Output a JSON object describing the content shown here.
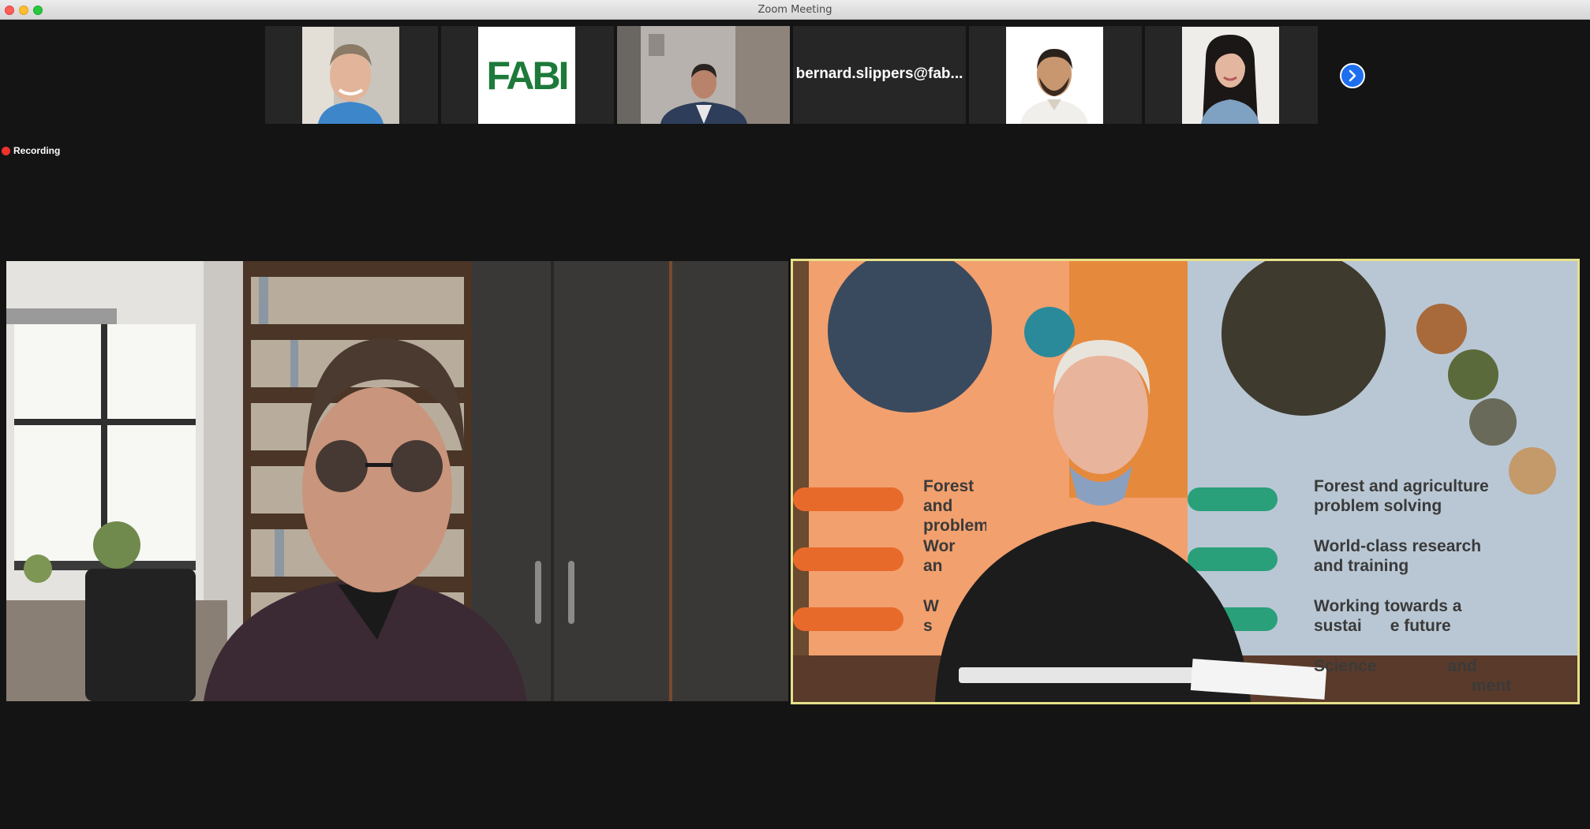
{
  "window": {
    "title": "Zoom Meeting"
  },
  "thumbnails": [
    {
      "type": "video",
      "participant": "participant-1"
    },
    {
      "type": "logo",
      "logo_text": "FABI"
    },
    {
      "type": "video",
      "participant": "participant-3"
    },
    {
      "type": "name",
      "name": "bernard.slippers@fab..."
    },
    {
      "type": "video",
      "participant": "participant-5"
    },
    {
      "type": "video",
      "participant": "participant-6"
    }
  ],
  "next_page_icon": "chevron-right-icon",
  "recording": {
    "label": "Recording",
    "color": "#f0322f"
  },
  "active_speaker_border": "#e6e08a",
  "backdrop": {
    "left_panel": [
      "Forest and",
      "problem",
      "Wor",
      "an",
      "W",
      "s"
    ],
    "right_panel": {
      "line1a": "Forest and agriculture",
      "line1b": "problem solving",
      "line2a": "World-class research",
      "line2b": "and training",
      "line3a": "Working towards a",
      "line3b": "sustai",
      "line3c": "e future",
      "line4a": "Science",
      "line4b": "and",
      "line4c": "ment"
    }
  }
}
